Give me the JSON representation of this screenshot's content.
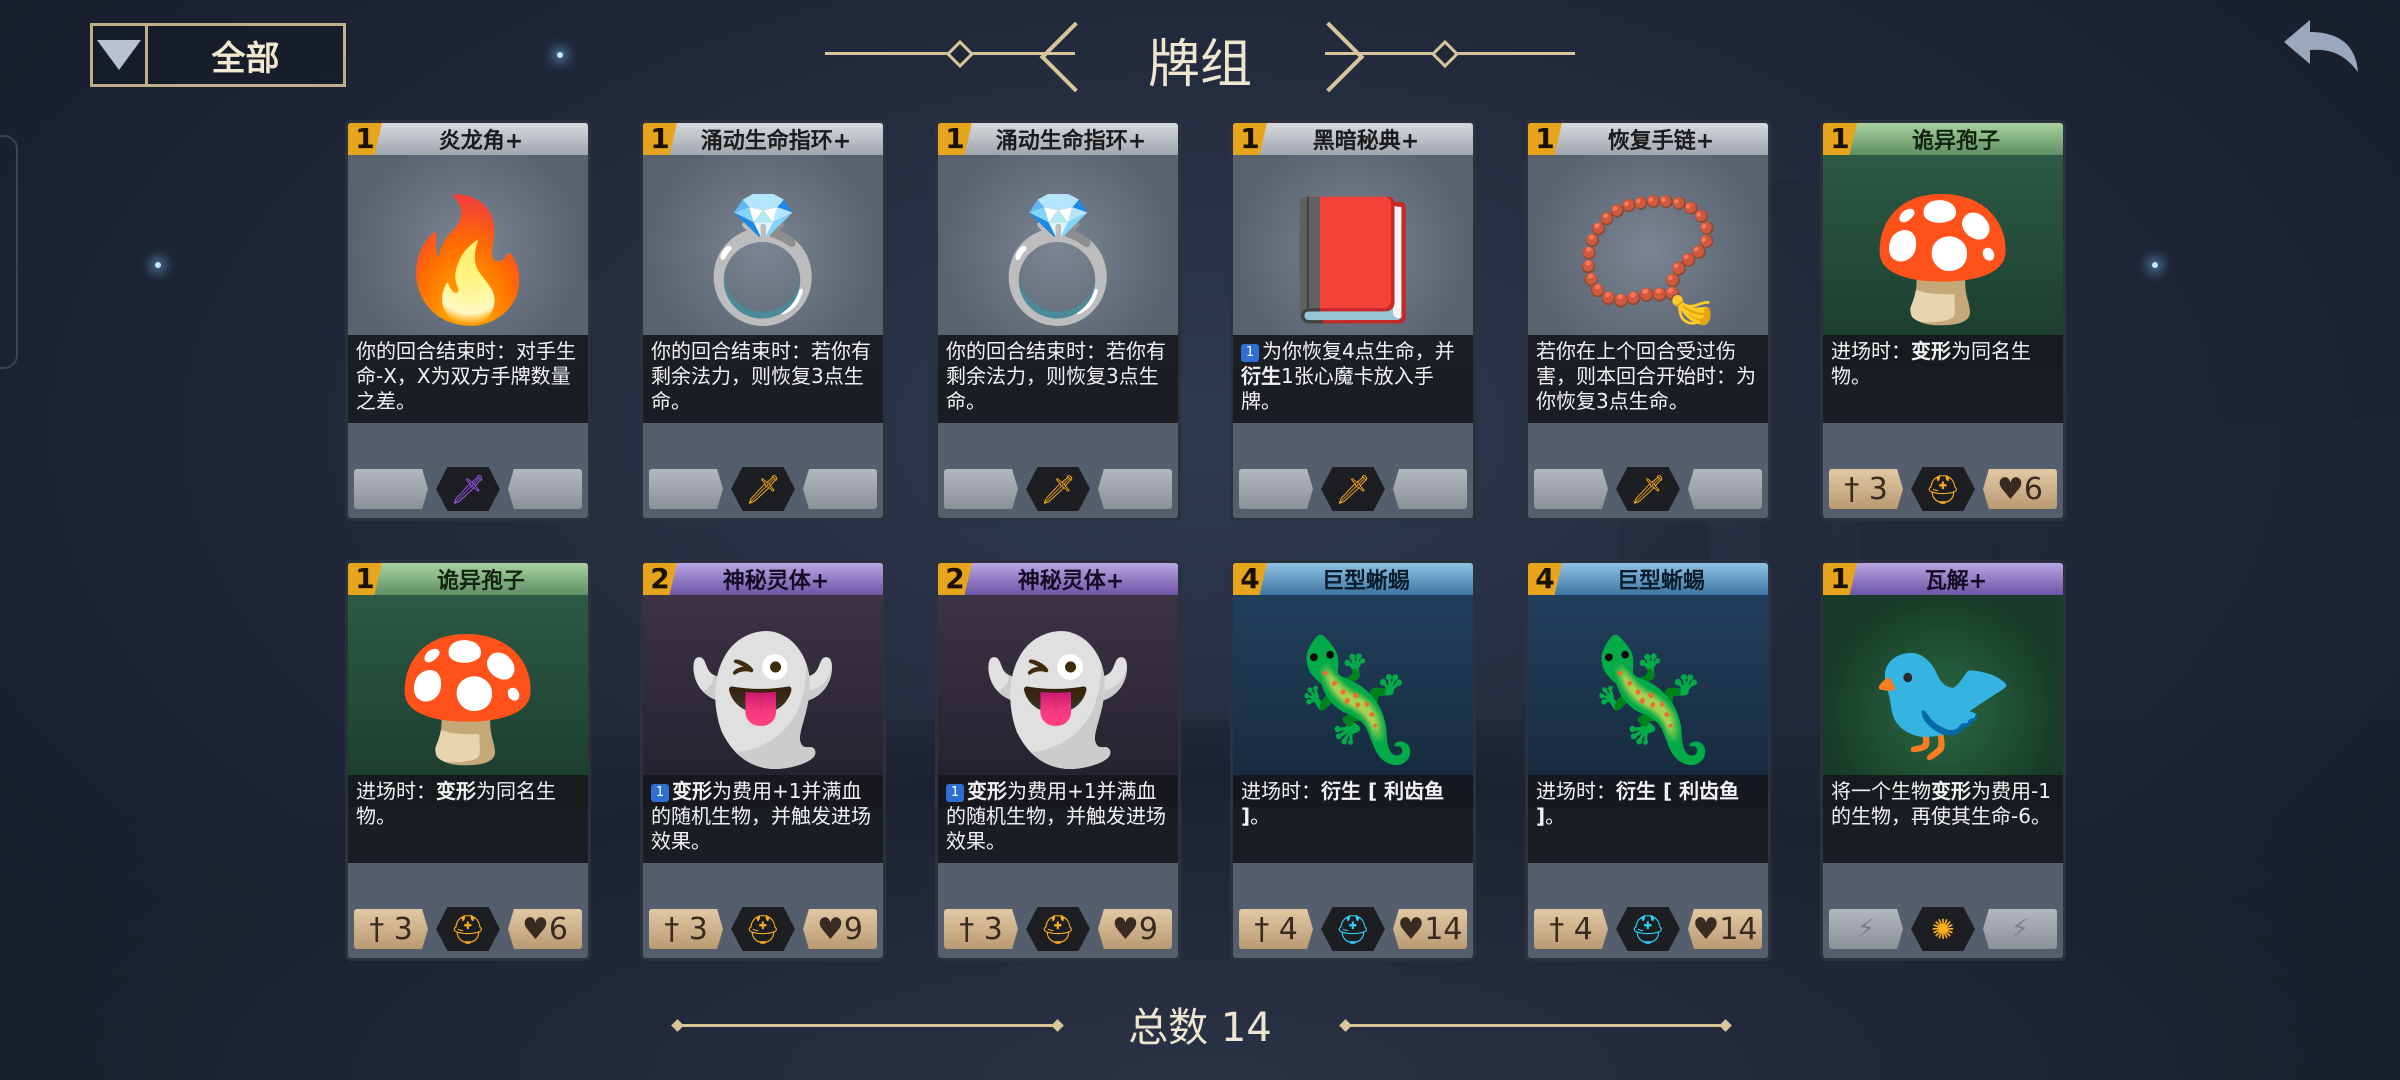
{
  "filter": {
    "label": "全部"
  },
  "title": "牌组",
  "colors": {
    "accent_gold": "#d8c59a",
    "cost": "#e6a51c"
  },
  "cards": [
    {
      "cost": "1",
      "name": "炎龙角+",
      "band": "silver",
      "art": "rel",
      "icon": "flame-horn",
      "desc": "你的回合结束时：对手生命-X，X为双方手牌数量之差。",
      "bold": [],
      "gem": "purple",
      "glyph": "🗡"
    },
    {
      "cost": "1",
      "name": "涌动生命指环+",
      "band": "silver",
      "art": "rel",
      "icon": "ring",
      "desc": "你的回合结束时：若你有剩余法力，则恢复3点生命。",
      "gem": "orange",
      "glyph": "🗡"
    },
    {
      "cost": "1",
      "name": "涌动生命指环+",
      "band": "silver",
      "art": "rel",
      "icon": "ring",
      "desc": "你的回合结束时：若你有剩余法力，则恢复3点生命。",
      "gem": "orange",
      "glyph": "🗡"
    },
    {
      "cost": "1",
      "name": "黑暗秘典+",
      "band": "silver",
      "art": "rel",
      "icon": "book",
      "desc_parts": [
        "为你恢复4点生命，并",
        "衍生",
        "1张心魔卡放入手牌。"
      ],
      "badge": "1",
      "gem": "orange",
      "glyph": "🗡"
    },
    {
      "cost": "1",
      "name": "恢复手链+",
      "band": "silver",
      "art": "rel",
      "icon": "bracelet",
      "desc": "若你在上个回合受过伤害，则本回合开始时：为你恢复3点生命。",
      "gem": "orange",
      "glyph": "🗡"
    },
    {
      "cost": "1",
      "name": "诡异孢子",
      "band": "green",
      "art": "forest",
      "icon": "spore",
      "desc_parts": [
        "进场时：",
        "变形",
        "为同名生物。"
      ],
      "creature": {
        "atk": "3",
        "hp": "6"
      },
      "gem": "orange",
      "glyph": "⛑"
    },
    {
      "cost": "1",
      "name": "诡异孢子",
      "band": "green",
      "art": "forest",
      "icon": "spore",
      "desc_parts": [
        "进场时：",
        "变形",
        "为同名生物。"
      ],
      "creature": {
        "atk": "3",
        "hp": "6"
      },
      "gem": "orange",
      "glyph": "⛑"
    },
    {
      "cost": "2",
      "name": "神秘灵体+",
      "band": "purple",
      "art": "arcane",
      "icon": "spirit",
      "desc_parts": [
        "",
        "变形",
        "为费用+1并满血的随机生物，并触发进场效果。"
      ],
      "badge": "1",
      "creature": {
        "atk": "3",
        "hp": "9"
      },
      "gem": "orange",
      "glyph": "⛑"
    },
    {
      "cost": "2",
      "name": "神秘灵体+",
      "band": "purple",
      "art": "arcane",
      "icon": "spirit",
      "desc_parts": [
        "",
        "变形",
        "为费用+1并满血的随机生物，并触发进场效果。"
      ],
      "badge": "1",
      "creature": {
        "atk": "3",
        "hp": "9"
      },
      "gem": "orange",
      "glyph": "⛑"
    },
    {
      "cost": "4",
      "name": "巨型蜥蜴",
      "band": "blue",
      "art": "night",
      "icon": "lizard",
      "desc_parts": [
        "进场时：",
        "衍生 [ 利齿鱼 ]",
        "。"
      ],
      "creature": {
        "atk": "4",
        "hp": "14"
      },
      "gem": "cyan",
      "glyph": "⛑"
    },
    {
      "cost": "4",
      "name": "巨型蜥蜴",
      "band": "blue",
      "art": "night",
      "icon": "lizard",
      "desc_parts": [
        "进场时：",
        "衍生 [ 利齿鱼 ]",
        "。"
      ],
      "creature": {
        "atk": "4",
        "hp": "14"
      },
      "gem": "cyan",
      "glyph": "⛑"
    },
    {
      "cost": "1",
      "name": "瓦解+",
      "band": "purple",
      "art": "spell",
      "icon": "raven-orb",
      "desc_parts": [
        "将一个生物",
        "变形",
        "为费用-1的生物，再使其生命-6。"
      ],
      "spell": true,
      "gem": "orange",
      "glyph": "✺"
    }
  ],
  "total_label": "总数 14"
}
